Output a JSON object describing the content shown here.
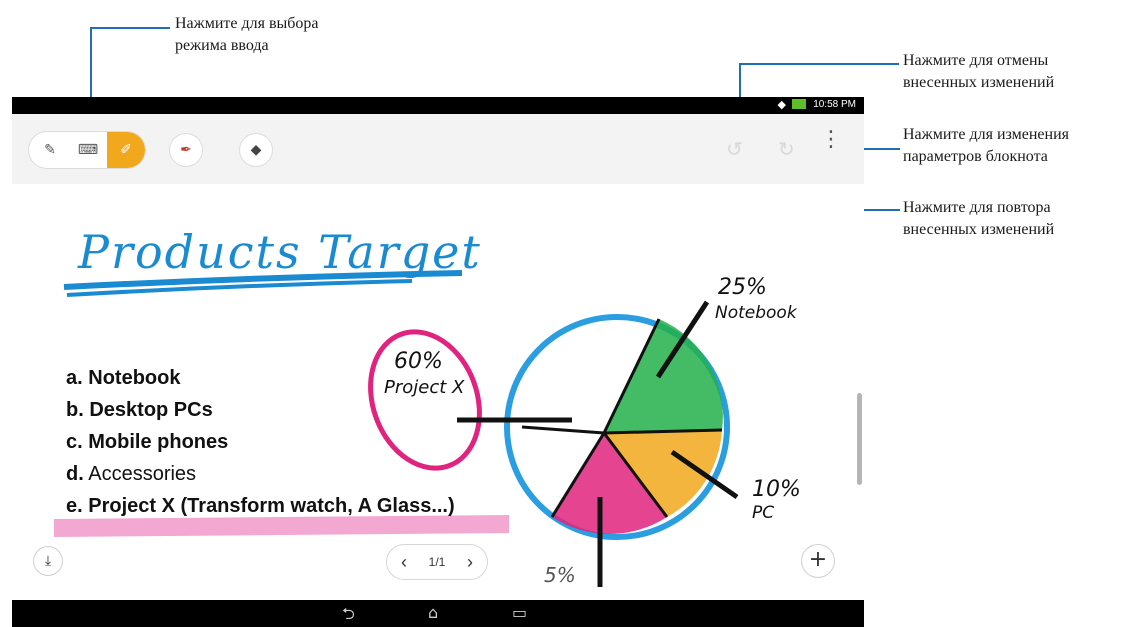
{
  "callouts": {
    "input_mode": [
      "Нажмите для выбора",
      "режима ввода"
    ],
    "undo": [
      "Нажмите для отмены",
      "внесенных изменений"
    ],
    "settings": [
      "Нажмите для изменения",
      "параметров блокнота"
    ],
    "redo": [
      "Нажмите для повтора",
      "внесенных изменений"
    ]
  },
  "statusbar": {
    "time": "10:58 PM",
    "wifi_icon": "wifi-icon",
    "battery_icon": "battery-icon"
  },
  "toolbar": {
    "modes": [
      {
        "name": "handwriting-mode",
        "icon": "✎"
      },
      {
        "name": "keyboard-mode",
        "icon": "⌨"
      },
      {
        "name": "draw-mode",
        "icon": "✐"
      }
    ],
    "pen_icon": "✒",
    "eraser_icon": "◆",
    "undo_icon": "↺",
    "redo_icon": "↻",
    "menu_icon": "⋮"
  },
  "note": {
    "title": "Products Target",
    "list": [
      {
        "prefix": "a.",
        "text": "Notebook",
        "bold": true
      },
      {
        "prefix": "b.",
        "text": "Desktop PCs",
        "bold": true
      },
      {
        "prefix": "c.",
        "text": "Mobile phones",
        "bold": true
      },
      {
        "prefix": "d.",
        "text": "Accessories",
        "bold": false
      },
      {
        "prefix": "e.",
        "text": "Project X (Transform watch, A Glass...)",
        "bold": true
      }
    ],
    "labels": {
      "notebook_pct": "25%",
      "notebook": "Notebook",
      "projectx_pct": "60%",
      "projectx": "Project X",
      "pc_pct": "10%",
      "pc": "PC",
      "other_pct": "5%"
    },
    "colors": {
      "pen_blue": "#1a8bd1",
      "green": "#22b04a",
      "orange": "#f2a81d",
      "magenta": "#e0237e",
      "highlight": "#f3a8d2"
    }
  },
  "pager": {
    "prev": "‹",
    "page": "1/1",
    "next": "›"
  },
  "footer_buttons": {
    "export_icon": "⤓",
    "add_icon": "+"
  },
  "navbar": {
    "back_icon": "⮌",
    "home_icon": "⌂",
    "recents_icon": "▭"
  }
}
